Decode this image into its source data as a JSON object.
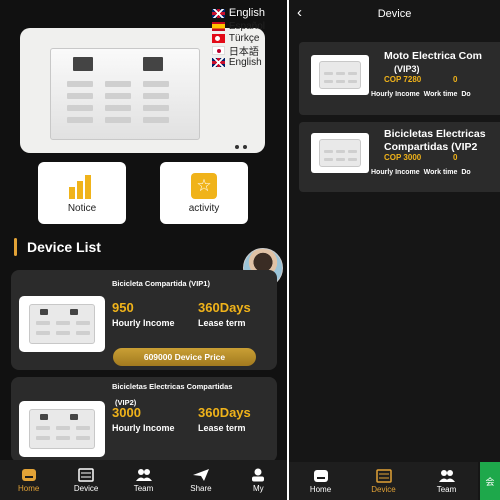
{
  "left": {
    "languages": {
      "selected": "English",
      "options": [
        "Español",
        "Türkçe",
        "日本語",
        "English"
      ]
    },
    "quick_links": [
      {
        "label": "Notice",
        "icon": "bar-chart-icon"
      },
      {
        "label": "activity",
        "icon": "star-icon"
      }
    ],
    "section_title": "Device List",
    "devices": [
      {
        "name": "Bicicleta Compartida  (VIP1)",
        "hourly_value": "950",
        "hourly_label": "Hourly Income",
        "term_value": "360Days",
        "term_label": "Lease term",
        "price_label": "609000 Device Price"
      },
      {
        "name_line1": "Bicicletas Electricas Compartidas",
        "name_line2": "(VIP2)",
        "hourly_value": "3000",
        "hourly_label": "Hourly Income",
        "term_value": "360Days",
        "term_label": "Lease term"
      }
    ],
    "tabs": [
      {
        "label": "Home",
        "icon": "home-icon",
        "active": true
      },
      {
        "label": "Device",
        "icon": "device-icon",
        "active": false
      },
      {
        "label": "Team",
        "icon": "team-icon",
        "active": false
      },
      {
        "label": "Share",
        "icon": "share-icon",
        "active": false
      },
      {
        "label": "My",
        "icon": "user-icon",
        "active": false
      }
    ]
  },
  "right": {
    "header_title": "Device",
    "devices": [
      {
        "title_line1": "Moto Electrica Com",
        "title_line2": "(VIP3)",
        "price": "COP 7280",
        "count": "0",
        "meta": [
          "Hourly Income",
          "Work time",
          "Do"
        ]
      },
      {
        "title_line1": "Bicicletas Electricas",
        "title_line2": "Compartidas  (VIP2",
        "price": "COP 3000",
        "count": "0",
        "meta": [
          "Hourly Income",
          "Work time",
          "Do"
        ]
      }
    ],
    "tabs": [
      {
        "label": "Home",
        "icon": "home-icon",
        "active": false
      },
      {
        "label": "Device",
        "icon": "device-icon",
        "active": true
      },
      {
        "label": "Team",
        "icon": "team-icon",
        "active": false
      }
    ],
    "side_button": "会"
  },
  "colors": {
    "accent": "#f0b31a",
    "active_tab": "#e2a236",
    "card_bg": "#2b2b2b",
    "page_bg": "#111111",
    "service_green": "#1ea84b"
  }
}
